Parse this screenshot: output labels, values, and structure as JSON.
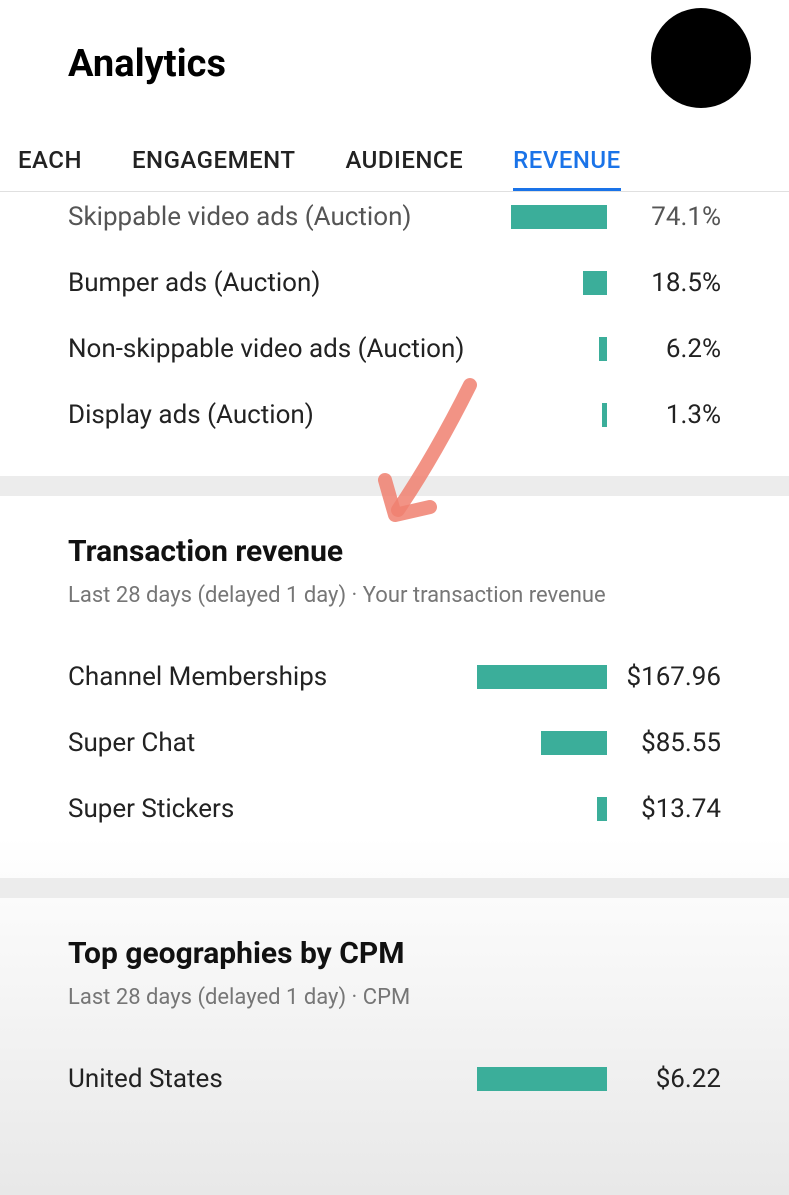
{
  "header": {
    "title": "Analytics"
  },
  "tabs": [
    {
      "label": "EACH",
      "active": false
    },
    {
      "label": "ENGAGEMENT",
      "active": false
    },
    {
      "label": "AUDIENCE",
      "active": false
    },
    {
      "label": "REVENUE",
      "active": true
    }
  ],
  "ad_types": {
    "items": [
      {
        "label": "Skippable video ads (Auction)",
        "value": "74.1%",
        "pct": 74.1
      },
      {
        "label": "Bumper ads (Auction)",
        "value": "18.5%",
        "pct": 18.5
      },
      {
        "label": "Non-skippable video ads (Auction)",
        "value": "6.2%",
        "pct": 6.2
      },
      {
        "label": "Display ads (Auction)",
        "value": "1.3%",
        "pct": 1.3
      }
    ]
  },
  "transaction": {
    "title": "Transaction revenue",
    "subtitle": "Last 28 days (delayed 1 day) · Your transaction revenue",
    "items": [
      {
        "label": "Channel Memberships",
        "value": "$167.96",
        "pct": 100
      },
      {
        "label": "Super Chat",
        "value": "$85.55",
        "pct": 51
      },
      {
        "label": "Super Stickers",
        "value": "$13.74",
        "pct": 8
      }
    ]
  },
  "geo": {
    "title": "Top geographies by CPM",
    "subtitle": "Last 28 days (delayed 1 day) · CPM",
    "items": [
      {
        "label": "United States",
        "value": "$6.22",
        "pct": 100
      }
    ]
  },
  "chart_data": [
    {
      "type": "bar",
      "title": "Ad types",
      "categories": [
        "Skippable video ads (Auction)",
        "Bumper ads (Auction)",
        "Non-skippable video ads (Auction)",
        "Display ads (Auction)"
      ],
      "values": [
        74.1,
        18.5,
        6.2,
        1.3
      ],
      "ylabel": "%"
    },
    {
      "type": "bar",
      "title": "Transaction revenue",
      "categories": [
        "Channel Memberships",
        "Super Chat",
        "Super Stickers"
      ],
      "values": [
        167.96,
        85.55,
        13.74
      ],
      "ylabel": "$"
    },
    {
      "type": "bar",
      "title": "Top geographies by CPM",
      "categories": [
        "United States"
      ],
      "values": [
        6.22
      ],
      "ylabel": "$"
    }
  ],
  "colors": {
    "accent": "#1a73e8",
    "bar": "#3bae9a"
  }
}
